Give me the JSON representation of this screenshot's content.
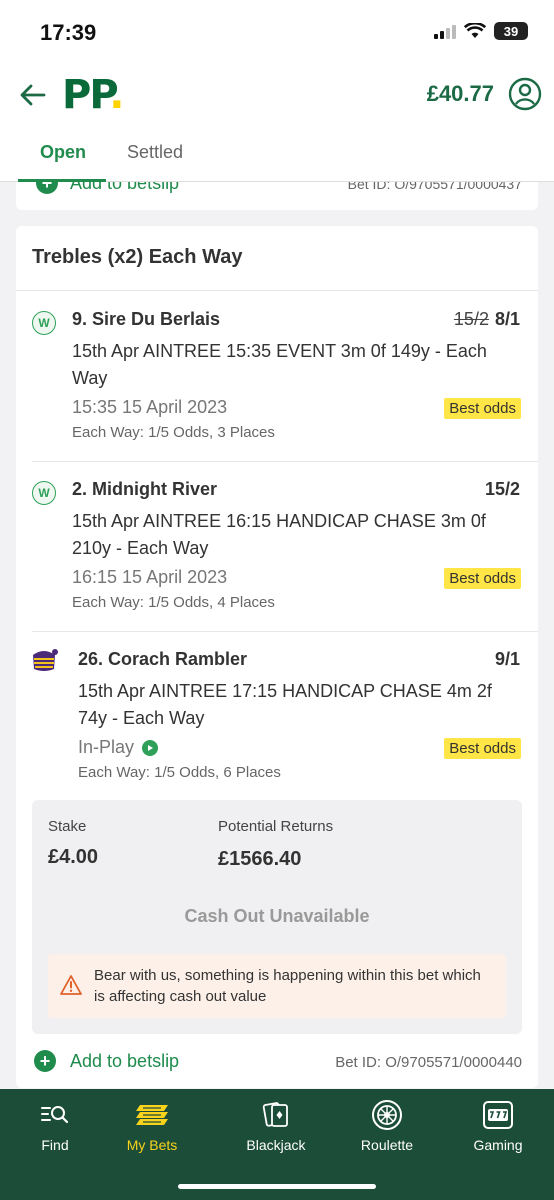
{
  "status_bar": {
    "time": "17:39",
    "battery": "39"
  },
  "header": {
    "logo": "PP",
    "balance": "£40.77"
  },
  "tabs": [
    {
      "label": "Open"
    },
    {
      "label": "Settled"
    }
  ],
  "previous_bet": {
    "add_label": "Add to betslip",
    "bet_id": "Bet ID: O/9705571/0000437"
  },
  "bet": {
    "title": "Trebles (x2) Each Way",
    "selections": [
      {
        "name": "9. Sire Du Berlais",
        "old_odds": "15/2",
        "odds": "8/1",
        "market": "15th Apr AINTREE 15:35 EVENT 3m 0f 149y - Each Way",
        "time": "15:35 15 April 2023",
        "best_odds": "Best odds",
        "each_way": "Each Way: 1/5 Odds, 3 Places",
        "result_badge": "W"
      },
      {
        "name": "2. Midnight River",
        "odds": "15/2",
        "market": "15th Apr AINTREE 16:15 HANDICAP CHASE 3m 0f 210y - Each Way",
        "time": "16:15 15 April 2023",
        "best_odds": "Best odds",
        "each_way": "Each Way: 1/5 Odds, 4 Places",
        "result_badge": "W"
      },
      {
        "name": "26. Corach Rambler",
        "odds": "9/1",
        "market": "15th Apr AINTREE 17:15 HANDICAP CHASE 4m 2f 74y - Each Way",
        "status": "In-Play",
        "best_odds": "Best odds",
        "each_way": "Each Way: 1/5 Odds, 6 Places"
      }
    ],
    "stake_label": "Stake",
    "stake": "£4.00",
    "returns_label": "Potential Returns",
    "returns": "£1566.40",
    "cashout": "Cash Out Unavailable",
    "warning": "Bear with us, something is happening within this bet which is affecting cash out value",
    "add_label": "Add to betslip",
    "bet_id": "Bet ID: O/9705571/0000440"
  },
  "nav": [
    {
      "label": "Find",
      "icon": "search-list-icon"
    },
    {
      "label": "My Bets",
      "icon": "bet-slips-icon"
    },
    {
      "label": "Blackjack",
      "icon": "cards-icon"
    },
    {
      "label": "Roulette",
      "icon": "roulette-icon"
    },
    {
      "label": "Gaming",
      "icon": "slot-machine-icon"
    }
  ],
  "colors": {
    "brand_green": "#1f8b4c",
    "nav_bg": "#1c4d39",
    "best_odds_bg": "#ffe545",
    "active_nav": "#f8d21b"
  }
}
